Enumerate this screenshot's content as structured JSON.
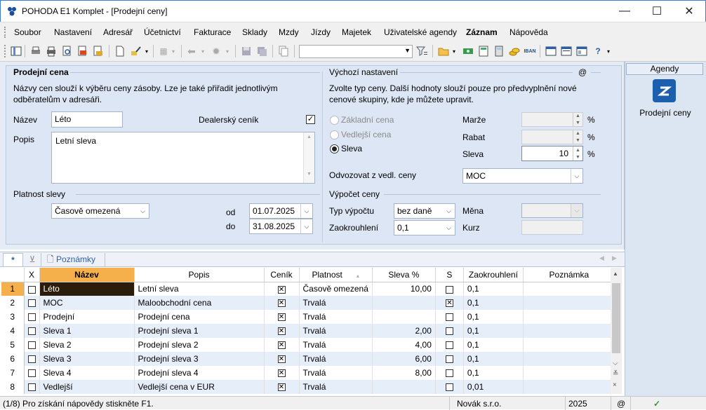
{
  "window": {
    "title": "POHODA E1 Komplet - [Prodejní ceny]",
    "minimize": "—",
    "maximize": "☐",
    "close": "✕"
  },
  "menu": [
    "Soubor",
    "Nastavení",
    "Adresář",
    "Účetnictví",
    "Fakturace",
    "Sklady",
    "Mzdy",
    "Jízdy",
    "Majetek",
    "Uživatelské agendy",
    "Záznam",
    "Nápověda"
  ],
  "form": {
    "section_price": "Prodejní cena",
    "price_desc": "Názvy cen slouží k výběru ceny zásoby. Lze je také přiřadit jednotlivým odběratelům v adresáři.",
    "name_label": "Název",
    "name_value": "Léto",
    "dealer_label": "Dealerský ceník",
    "dealer_checked": "✓",
    "desc_label": "Popis",
    "desc_value": "Letní sleva",
    "validity_section": "Platnost slevy",
    "validity_value": "Časově omezená",
    "from_label": "od",
    "from_value": "01.07.2025",
    "to_label": "do",
    "to_value": "31.08.2025",
    "defaults_section": "Výchozí nastavení",
    "defaults_at": "@",
    "defaults_desc": "Zvolte typ ceny. Další hodnoty slouží pouze pro předvyplnění nové cenové skupiny, kde je můžete upravit.",
    "radio_basic": "Základní cena",
    "radio_secondary": "Vedlejší cena",
    "radio_discount": "Sleva",
    "margin_label": "Marže",
    "rebate_label": "Rabat",
    "discount_label": "Sleva",
    "discount_value": "10",
    "percent": "%",
    "derive_label": "Odvozovat z vedl. ceny",
    "derive_value": "MOC",
    "calc_section": "Výpočet ceny",
    "calc_type_label": "Typ výpočtu",
    "calc_type_value": "bez daně",
    "rounding_label": "Zaokrouhlení",
    "rounding_value": "0,1",
    "currency_label": "Měna",
    "rate_label": "Kurz"
  },
  "tabs": {
    "star": "*",
    "notes": "Poznámky"
  },
  "grid": {
    "headers": [
      "X",
      "Název",
      "Popis",
      "Ceník",
      "Platnost",
      "Sleva %",
      "S",
      "Zaokrouhlení",
      "Poznámka"
    ],
    "rows": [
      {
        "n": "1",
        "name": "Léto",
        "desc": "Letní sleva",
        "cenik": "✕",
        "platnost": "Časově omezená",
        "sleva": "10,00",
        "s": "",
        "zaok": "0,1"
      },
      {
        "n": "2",
        "name": "MOC",
        "desc": "Maloobchodní cena",
        "cenik": "✕",
        "platnost": "Trvalá",
        "sleva": "",
        "s": "✕",
        "zaok": "0,1"
      },
      {
        "n": "3",
        "name": "Prodejní",
        "desc": "Prodejní cena",
        "cenik": "✕",
        "platnost": "Trvalá",
        "sleva": "",
        "s": "",
        "zaok": "0,1"
      },
      {
        "n": "4",
        "name": "Sleva 1",
        "desc": "Prodejní sleva 1",
        "cenik": "✕",
        "platnost": "Trvalá",
        "sleva": "2,00",
        "s": "",
        "zaok": "0,1"
      },
      {
        "n": "5",
        "name": "Sleva 2",
        "desc": "Prodejní sleva 2",
        "cenik": "✕",
        "platnost": "Trvalá",
        "sleva": "4,00",
        "s": "",
        "zaok": "0,1"
      },
      {
        "n": "6",
        "name": "Sleva 3",
        "desc": "Prodejní sleva 3",
        "cenik": "✕",
        "platnost": "Trvalá",
        "sleva": "6,00",
        "s": "",
        "zaok": "0,1"
      },
      {
        "n": "7",
        "name": "Sleva 4",
        "desc": "Prodejní sleva 4",
        "cenik": "✕",
        "platnost": "Trvalá",
        "sleva": "8,00",
        "s": "",
        "zaok": "0,1"
      },
      {
        "n": "8",
        "name": "Vedlejší",
        "desc": "Vedlejší cena v EUR",
        "cenik": "✕",
        "platnost": "Trvalá",
        "sleva": "",
        "s": "",
        "zaok": "0,01"
      }
    ]
  },
  "status": {
    "record": "(1/8) Pro získání nápovědy stiskněte F1.",
    "company": "Novák s.r.o.",
    "year": "2025",
    "at": "@",
    "ok": "✓"
  },
  "agendy": {
    "title": "Agendy",
    "item": "Prodejní ceny"
  }
}
